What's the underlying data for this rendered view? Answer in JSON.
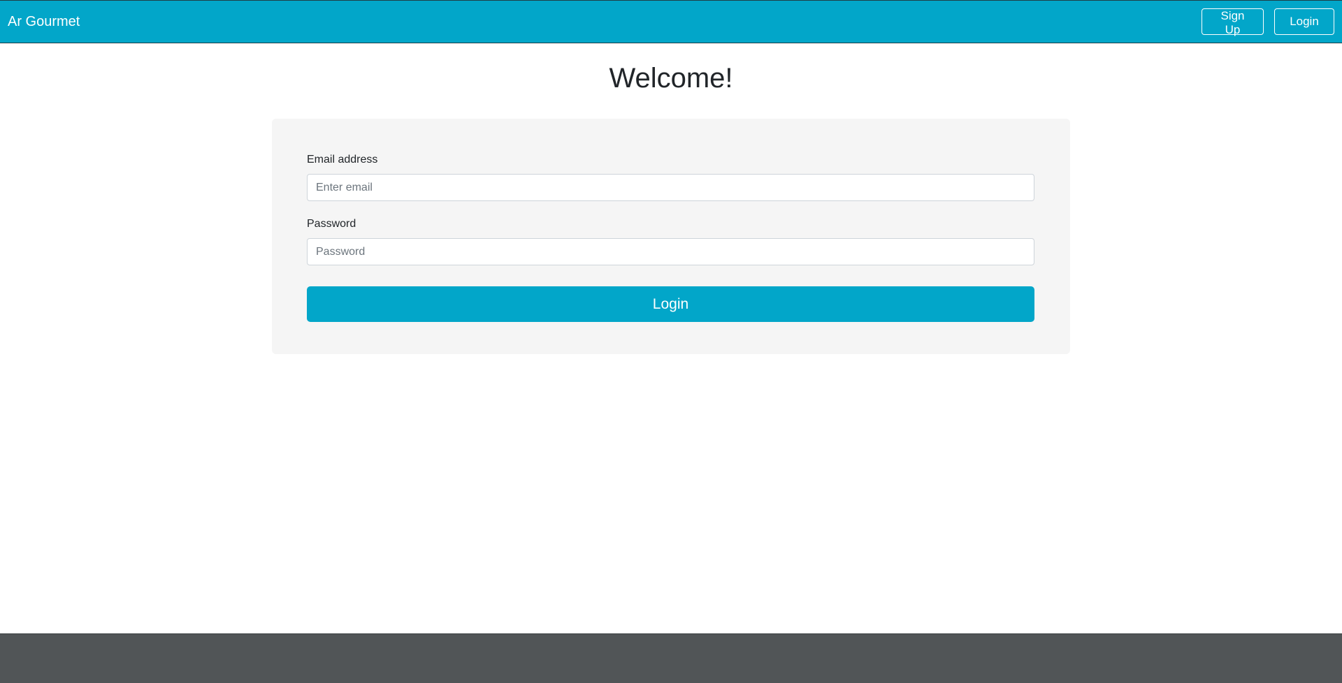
{
  "navbar": {
    "brand": "Ar Gourmet",
    "signup_label": "Sign Up",
    "login_label": "Login"
  },
  "main": {
    "title": "Welcome!"
  },
  "form": {
    "email_label": "Email address",
    "email_placeholder": "Enter email",
    "email_value": "",
    "password_label": "Password",
    "password_placeholder": "Password",
    "password_value": "",
    "submit_label": "Login"
  },
  "colors": {
    "accent": "#02a6c9",
    "card_bg": "#f5f5f5",
    "footer_bg": "#515557"
  }
}
